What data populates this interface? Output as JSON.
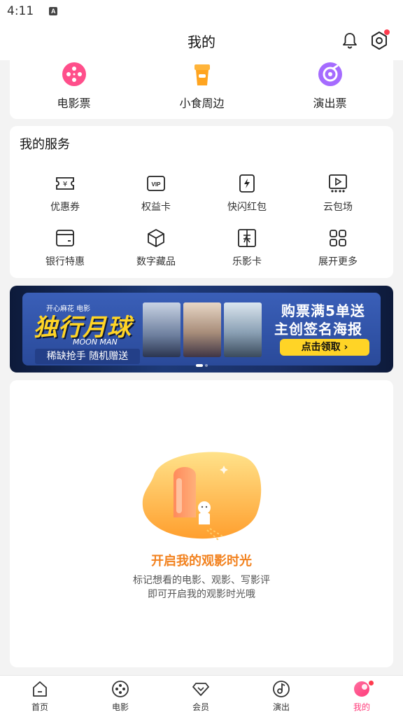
{
  "status_bar": {
    "time": "4:11",
    "badge": "A"
  },
  "header": {
    "title": "我的"
  },
  "top_shortcuts": [
    {
      "label": "电影票",
      "icon": "film-reel-icon",
      "color": "#ff4f8b"
    },
    {
      "label": "小食周边",
      "icon": "drink-cup-icon",
      "color": "#ffa41f"
    },
    {
      "label": "演出票",
      "icon": "music-disc-icon",
      "color": "#9a5cff"
    }
  ],
  "services": {
    "title": "我的服务",
    "items": [
      {
        "label": "优惠券",
        "icon": "coupon-icon"
      },
      {
        "label": "权益卡",
        "icon": "vip-card-icon"
      },
      {
        "label": "快闪红包",
        "icon": "flash-redpacket-icon"
      },
      {
        "label": "云包场",
        "icon": "cloud-screening-icon"
      },
      {
        "label": "银行特惠",
        "icon": "bank-card-icon"
      },
      {
        "label": "数字藏品",
        "icon": "cube-icon"
      },
      {
        "label": "乐影卡",
        "icon": "movie-card-icon"
      },
      {
        "label": "展开更多",
        "icon": "grid-more-icon"
      }
    ]
  },
  "banner": {
    "small_text": "开心麻花 电影",
    "movie_title": "独行月球",
    "movie_title_en": "MOON MAN",
    "tag": "稀缺抢手 随机赠送",
    "promo_line1": "购票满5单送",
    "promo_line2": "主创签名海报",
    "cta": "点击领取 ›",
    "slide_index": 1,
    "slide_count": 2
  },
  "empty_state": {
    "title": "开启我的观影时光",
    "line1": "标记想看的电影、观影、写影评",
    "line2": "即可开启我的观影时光哦"
  },
  "tabbar": {
    "active": "我的",
    "accent": "#ff3b7a",
    "items": [
      {
        "label": "首页",
        "icon": "home-icon"
      },
      {
        "label": "电影",
        "icon": "film-reel-icon"
      },
      {
        "label": "会员",
        "icon": "diamond-icon"
      },
      {
        "label": "演出",
        "icon": "music-note-icon"
      },
      {
        "label": "我的",
        "icon": "profile-icon"
      }
    ]
  }
}
